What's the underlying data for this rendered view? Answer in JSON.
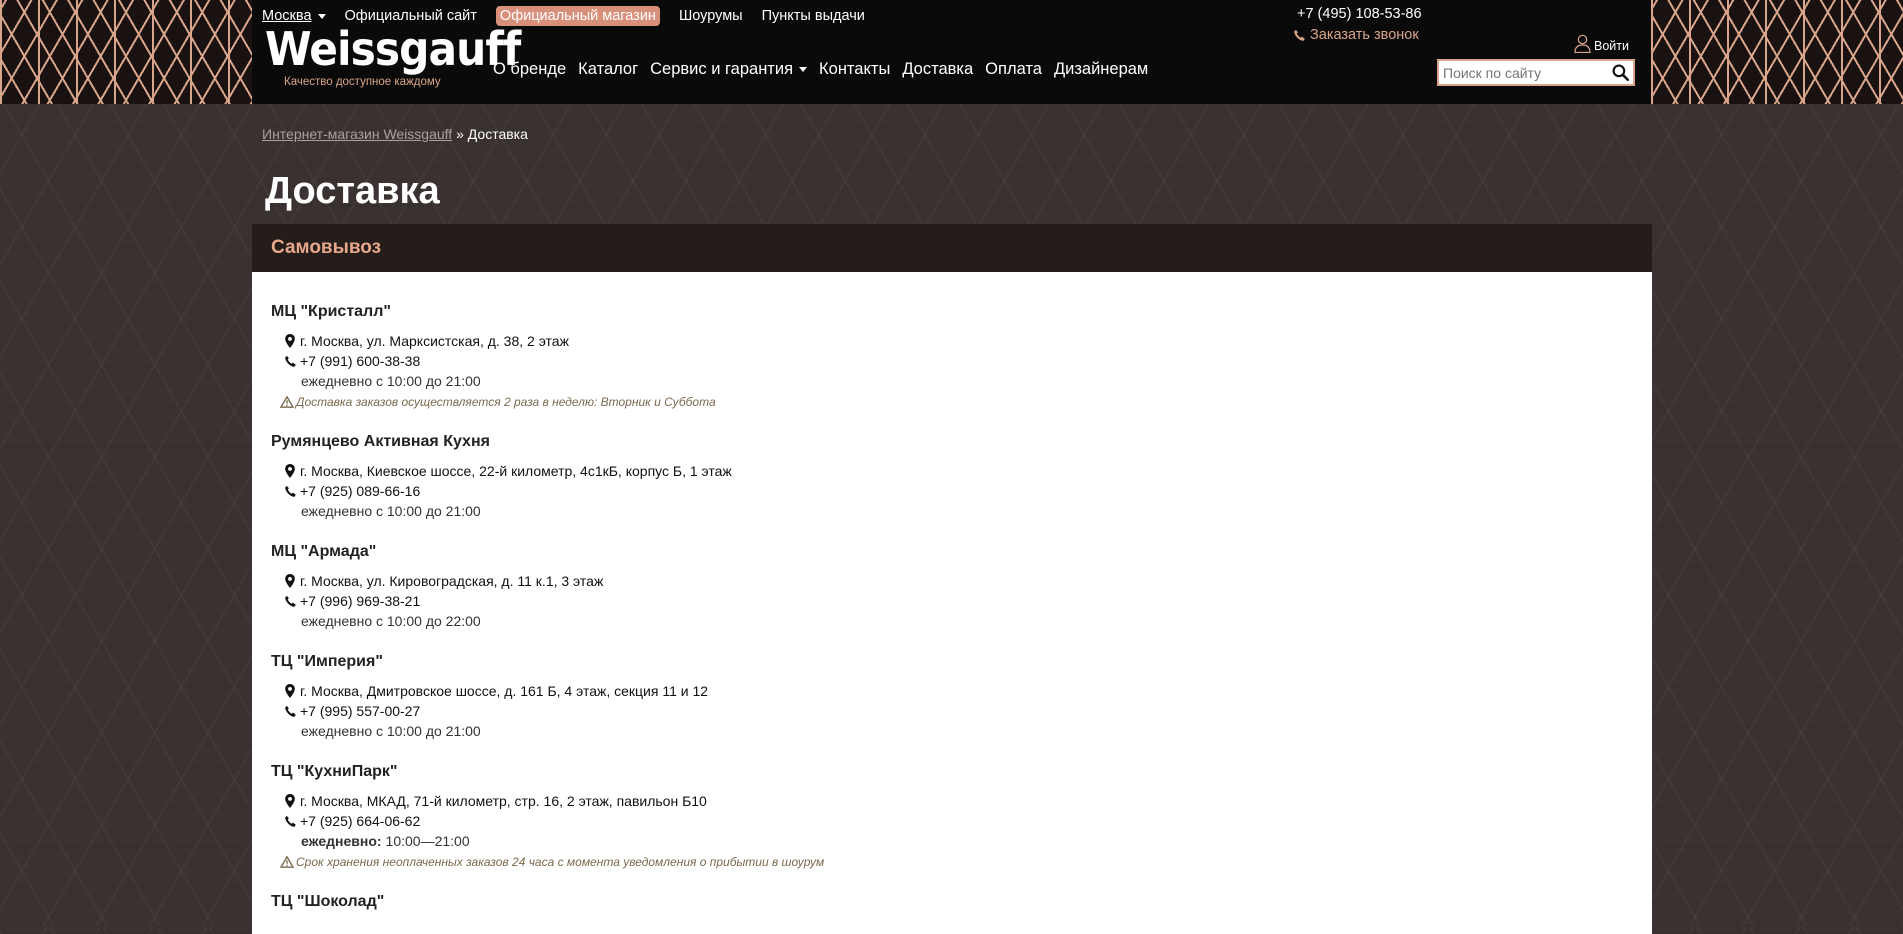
{
  "header": {
    "city": "Москва",
    "top_nav": [
      "Официальный сайт",
      "Официальный магазин",
      "Шоурумы",
      "Пункты выдачи"
    ],
    "logo": "Weissgauff",
    "tagline": "Качество доступное каждому",
    "main_nav": [
      "О бренде",
      "Каталог",
      "Сервис и гарантия",
      "Контакты",
      "Доставка",
      "Оплата",
      "Дизайнерам"
    ],
    "phone": "+7 (495) 108-53-86",
    "callback": "Заказать звонок",
    "login": "Войти",
    "search_placeholder": "Поиск по сайту",
    "accent_color": "#d9a58a"
  },
  "breadcrumb": {
    "home": "Интернет-магазин Weissgauff",
    "separator": "»",
    "current": "Доставка"
  },
  "page_title": "Доставка",
  "section_title": "Самовывоз",
  "locations": [
    {
      "name": "МЦ \"Кристалл\"",
      "address": "г. Москва, ул. Марксистская, д. 38, 2 этаж",
      "phone": "+7 (991) 600-38-38",
      "hours": "ежедневно с 10:00 до 21:00",
      "note": "Доставка заказов осуществляется 2 раза в неделю: Вторник и Суббота"
    },
    {
      "name": "Румянцево Активная Кухня",
      "address": "г. Москва, Киевское шоссе, 22-й километр, 4с1кБ, корпус Б, 1 этаж",
      "phone": "+7 (925) 089-66-16",
      "hours": "ежедневно с 10:00 до 21:00"
    },
    {
      "name": "МЦ \"Армада\"",
      "address": "г. Москва, ул. Кировоградская, д. 11 к.1, 3 этаж",
      "phone": "+7 (996) 969-38-21",
      "hours": "ежедневно с 10:00 до 22:00"
    },
    {
      "name": "ТЦ \"Империя\"",
      "address": "г. Москва, Дмитровское шоссе, д. 161 Б, 4 этаж, секция 11 и 12",
      "phone": "+7 (995) 557-00-27",
      "hours": "ежедневно с 10:00 до 21:00"
    },
    {
      "name": "ТЦ \"КухниПарк\"",
      "address": "г. Москва, МКАД, 71-й километр, стр. 16, 2 этаж, павильон Б10",
      "phone": "+7 (925) 664-06-62",
      "hours_label": "ежедневно:",
      "hours": "10:00—21:00",
      "note": "Срок хранения неоплаченных заказов 24 часа с момента уведомления о прибытии в шоурум"
    },
    {
      "name": "ТЦ \"Шоколад\""
    }
  ]
}
